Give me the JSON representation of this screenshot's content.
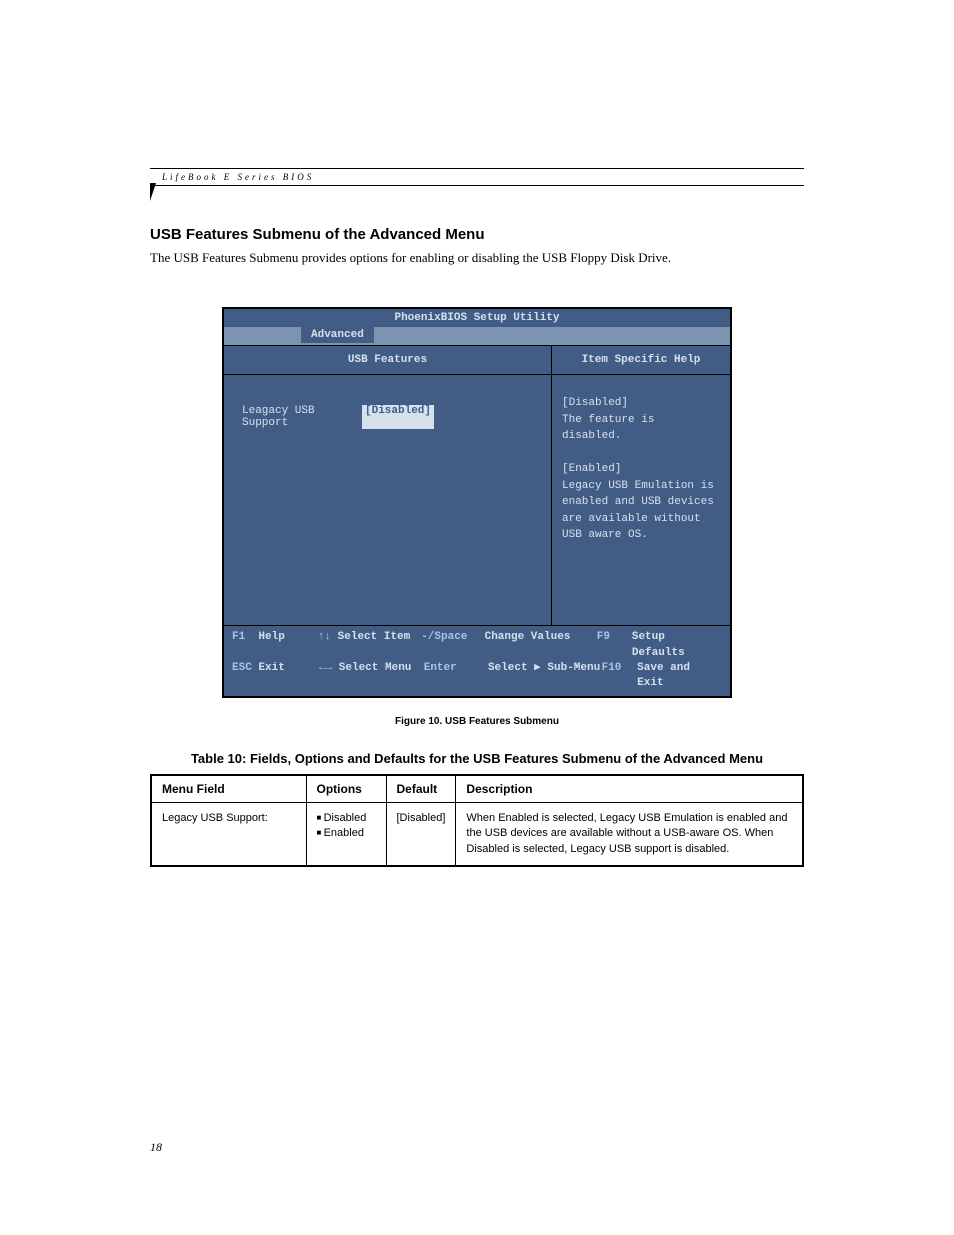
{
  "header": {
    "running_title": "LifeBook E Series BIOS"
  },
  "section": {
    "title": "USB Features Submenu of the Advanced Menu",
    "description": "The USB Features Submenu provides options for enabling or disabling the USB Floppy Disk Drive."
  },
  "bios": {
    "utility_title": "PhoenixBIOS Setup Utility",
    "active_tab": "Advanced",
    "left_header": "USB Features",
    "right_header": "Item Specific Help",
    "setting": {
      "label": "Leagacy USB Support",
      "value": "[Disabled]"
    },
    "help": {
      "disabled_title": "[Disabled]",
      "disabled_text": "The feature is disabled.",
      "enabled_title": "[Enabled]",
      "enabled_text": "Legacy USB Emulation is enabled and USB devices are available without USB aware OS."
    },
    "footer": {
      "f1": "F1",
      "help": "Help",
      "arrows_v": "↑↓",
      "select_item": "Select Item",
      "minus_space": "-/Space",
      "change_values": "Change Values",
      "f9": "F9",
      "setup_defaults": "Setup Defaults",
      "esc": "ESC",
      "exit": "Exit",
      "arrows_h": "←→",
      "select_menu": "Select Menu",
      "enter": "Enter",
      "select_submenu": "Select ▶ Sub-Menu",
      "f10": "F10",
      "save_exit": "Save and Exit"
    }
  },
  "figure_caption": "Figure 10.  USB Features Submenu",
  "table": {
    "title": "Table 10: Fields, Options and Defaults for the USB Features Submenu of the Advanced Menu",
    "headers": {
      "menu_field": "Menu Field",
      "options": "Options",
      "default": "Default",
      "description": "Description"
    },
    "rows": [
      {
        "menu_field": "Legacy USB Support:",
        "options": [
          "Disabled",
          "Enabled"
        ],
        "default": "[Disabled]",
        "description": "When Enabled is selected, Legacy USB Emulation is enabled and the USB devices are available without a USB-aware OS. When Disabled is selected, Legacy USB support is disabled."
      }
    ]
  },
  "page_number": "18"
}
